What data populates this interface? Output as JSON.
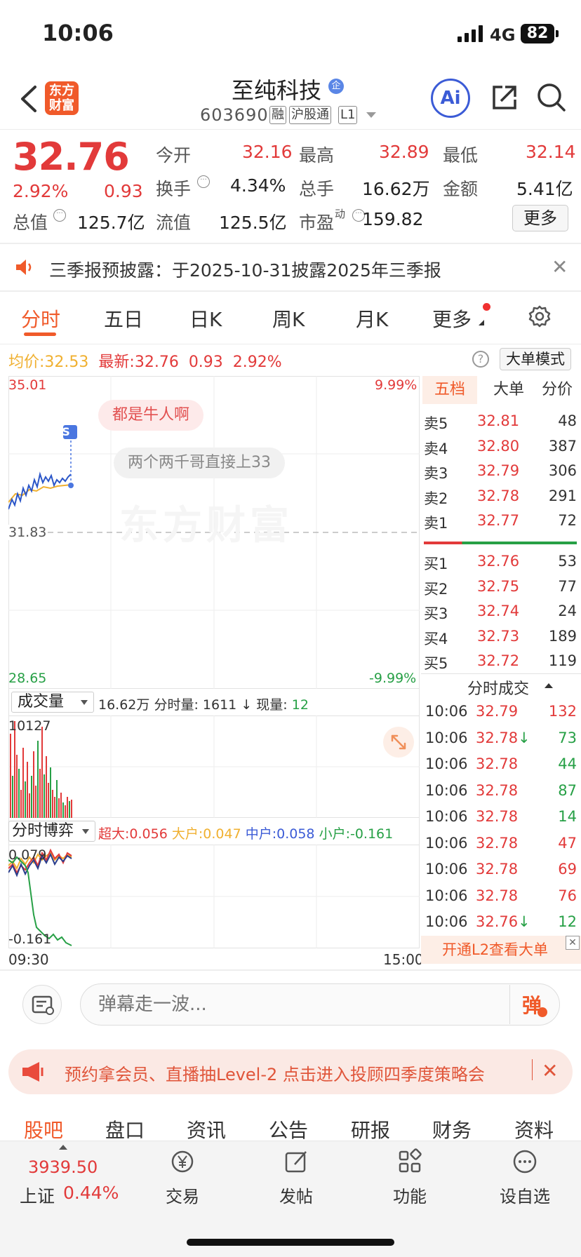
{
  "status": {
    "time": "10:06",
    "network": "4G",
    "battery": "82"
  },
  "header": {
    "name": "至纯科技",
    "badge": "企",
    "code": "603690",
    "tags": [
      "融",
      "沪股通",
      "L1"
    ],
    "logo_line1": "东方",
    "logo_line2": "财富",
    "ai": "Ai"
  },
  "quote": {
    "price": "32.76",
    "pct": "2.92%",
    "chg": "0.93",
    "rows": [
      [
        {
          "k": "今开",
          "v": "32.16",
          "c": "red"
        },
        {
          "k": "最高",
          "v": "32.89",
          "c": "red"
        },
        {
          "k": "最低",
          "v": "32.14",
          "c": "red"
        }
      ],
      [
        {
          "k": "换手",
          "v": "4.34%",
          "c": ""
        },
        {
          "k": "总手",
          "v": "16.62万",
          "c": ""
        },
        {
          "k": "金额",
          "v": "5.41亿",
          "c": ""
        }
      ],
      [
        {
          "k": "总值",
          "v": "125.7亿",
          "c": ""
        },
        {
          "k": "流值",
          "v": "125.5亿",
          "c": ""
        },
        {
          "k": "市盈",
          "v": "159.82",
          "c": ""
        }
      ]
    ],
    "pe_sup": "动",
    "more": "更多"
  },
  "notice": {
    "text": "三季报预披露：于2025-10-31披露2025年三季报"
  },
  "tabs": [
    "分时",
    "五日",
    "日K",
    "周K",
    "月K",
    "更多"
  ],
  "chart_info": {
    "avg_label": "均价:",
    "avg": "32.53",
    "last_label": "最新:",
    "last": "32.76",
    "chg": "0.93",
    "pct": "2.92%",
    "mode": "大单模式"
  },
  "chart_labels": {
    "top": "35.01",
    "top_pct": "9.99%",
    "mid": "31.83",
    "bottom": "28.65",
    "bottom_pct": "-9.99%",
    "watermark": "东方财富",
    "bubble1": "都是牛人啊",
    "bubble2": "两个两千哥直接上33",
    "s_marker": "S"
  },
  "volume": {
    "selector": "成交量",
    "total": "16.62万",
    "fs_label": "分时量:",
    "fs": "1611",
    "arrow": "↓",
    "now_label": "现量:",
    "now": "12",
    "max": "10127"
  },
  "game": {
    "selector": "分时博弈",
    "items": [
      {
        "k": "超大:",
        "v": "0.056",
        "c": "#e23a3a"
      },
      {
        "k": "大户:",
        "v": "0.047",
        "c": "#f0b030"
      },
      {
        "k": "中户:",
        "v": "0.058",
        "c": "#3b5bd6"
      },
      {
        "k": "小户:",
        "v": "-0.161",
        "c": "#27a046"
      }
    ],
    "top": "0.079",
    "bottom": "-0.161"
  },
  "axis": {
    "start": "09:30",
    "end": "15:00"
  },
  "orderbook": {
    "tabs": [
      "五档",
      "大单",
      "分价"
    ],
    "sell": [
      {
        "l": "卖5",
        "p": "32.81",
        "v": "48"
      },
      {
        "l": "卖4",
        "p": "32.80",
        "v": "387"
      },
      {
        "l": "卖3",
        "p": "32.79",
        "v": "306"
      },
      {
        "l": "卖2",
        "p": "32.78",
        "v": "291"
      },
      {
        "l": "卖1",
        "p": "32.77",
        "v": "72"
      }
    ],
    "buy": [
      {
        "l": "买1",
        "p": "32.76",
        "v": "53"
      },
      {
        "l": "买2",
        "p": "32.75",
        "v": "77"
      },
      {
        "l": "买3",
        "p": "32.74",
        "v": "24"
      },
      {
        "l": "买4",
        "p": "32.73",
        "v": "189"
      },
      {
        "l": "买5",
        "p": "32.72",
        "v": "119"
      }
    ],
    "ticks_title": "分时成交",
    "ticks": [
      {
        "t": "10:06",
        "p": "32.79",
        "a": "",
        "v": "132",
        "c": "red"
      },
      {
        "t": "10:06",
        "p": "32.78",
        "a": "↓",
        "v": "73",
        "c": "green"
      },
      {
        "t": "10:06",
        "p": "32.78",
        "a": "",
        "v": "44",
        "c": "green"
      },
      {
        "t": "10:06",
        "p": "32.78",
        "a": "",
        "v": "87",
        "c": "green"
      },
      {
        "t": "10:06",
        "p": "32.78",
        "a": "",
        "v": "14",
        "c": "green"
      },
      {
        "t": "10:06",
        "p": "32.78",
        "a": "",
        "v": "47",
        "c": "red"
      },
      {
        "t": "10:06",
        "p": "32.78",
        "a": "",
        "v": "69",
        "c": "red"
      },
      {
        "t": "10:06",
        "p": "32.78",
        "a": "",
        "v": "76",
        "c": "red"
      },
      {
        "t": "10:06",
        "p": "32.76",
        "a": "↓",
        "v": "12",
        "c": "green"
      }
    ],
    "l2": "开通L2查看大单"
  },
  "danmu": {
    "placeholder": "弹幕走一波...",
    "btn": "弹"
  },
  "banner": {
    "text": "预约拿会员、直播抽Level-2 点击进入投顾四季度策略会"
  },
  "bottom_tabs": [
    "股吧",
    "盘口",
    "资讯",
    "公告",
    "研报",
    "财务",
    "资料"
  ],
  "footer": {
    "index_value": "3939.50",
    "index_name": "上证",
    "index_pct": "0.44%",
    "items": [
      "交易",
      "发帖",
      "功能",
      "设自选"
    ]
  }
}
